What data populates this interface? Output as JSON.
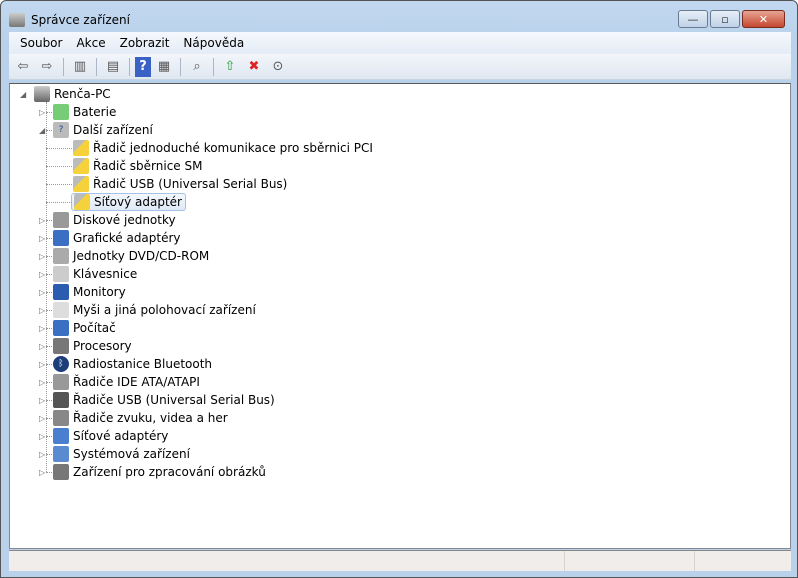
{
  "window": {
    "title": "Správce zařízení",
    "minimize": "—",
    "maximize": "▫",
    "close": "✕"
  },
  "menu": [
    "Soubor",
    "Akce",
    "Zobrazit",
    "Nápověda"
  ],
  "toolbar": [
    {
      "name": "back-icon",
      "glyph": "⇦"
    },
    {
      "name": "forward-icon",
      "glyph": "⇨"
    },
    {
      "sep": true
    },
    {
      "name": "show-hide-console-tree-icon",
      "glyph": "▥"
    },
    {
      "sep": true
    },
    {
      "name": "properties-icon",
      "glyph": "▤"
    },
    {
      "sep": true
    },
    {
      "name": "help-icon",
      "glyph": "?"
    },
    {
      "name": "show-action-pane-icon",
      "glyph": "▦"
    },
    {
      "sep": true
    },
    {
      "name": "scan-hardware-icon",
      "glyph": "⌕"
    },
    {
      "sep": true
    },
    {
      "name": "update-driver-icon",
      "glyph": "⇧"
    },
    {
      "name": "uninstall-icon",
      "glyph": "✖"
    },
    {
      "name": "disable-icon",
      "glyph": "⊙"
    }
  ],
  "tree": {
    "root": "Renča-PC",
    "items": [
      {
        "label": "Baterie",
        "icon": "battery-icon",
        "expanded": false
      },
      {
        "label": "Další zařízení",
        "icon": "unknown-device-icon",
        "expanded": true,
        "children": [
          {
            "label": "Řadič jednoduché komunikace pro sběrnici PCI",
            "icon": "warning-device-icon"
          },
          {
            "label": "Řadič sběrnice SM",
            "icon": "warning-device-icon"
          },
          {
            "label": "Řadič USB (Universal Serial Bus)",
            "icon": "warning-device-icon"
          },
          {
            "label": "Síťový adaptér",
            "icon": "warning-device-icon",
            "selected": true
          }
        ]
      },
      {
        "label": "Diskové jednotky",
        "icon": "disk-icon"
      },
      {
        "label": "Grafické adaptéry",
        "icon": "display-adapter-icon"
      },
      {
        "label": "Jednotky DVD/CD-ROM",
        "icon": "dvd-icon"
      },
      {
        "label": "Klávesnice",
        "icon": "keyboard-icon"
      },
      {
        "label": "Monitory",
        "icon": "monitor-icon"
      },
      {
        "label": "Myši a jiná polohovací zařízení",
        "icon": "mouse-icon"
      },
      {
        "label": "Počítač",
        "icon": "computer-icon"
      },
      {
        "label": "Procesory",
        "icon": "processor-icon"
      },
      {
        "label": "Radiostanice Bluetooth",
        "icon": "bluetooth-icon"
      },
      {
        "label": "Řadiče IDE ATA/ATAPI",
        "icon": "ide-icon"
      },
      {
        "label": "Řadiče USB (Universal Serial Bus)",
        "icon": "usb-icon"
      },
      {
        "label": "Řadiče zvuku, videa a her",
        "icon": "sound-icon"
      },
      {
        "label": "Síťové adaptéry",
        "icon": "network-icon"
      },
      {
        "label": "Systémová zařízení",
        "icon": "system-icon"
      },
      {
        "label": "Zařízení pro zpracování obrázků",
        "icon": "camera-icon"
      }
    ]
  }
}
